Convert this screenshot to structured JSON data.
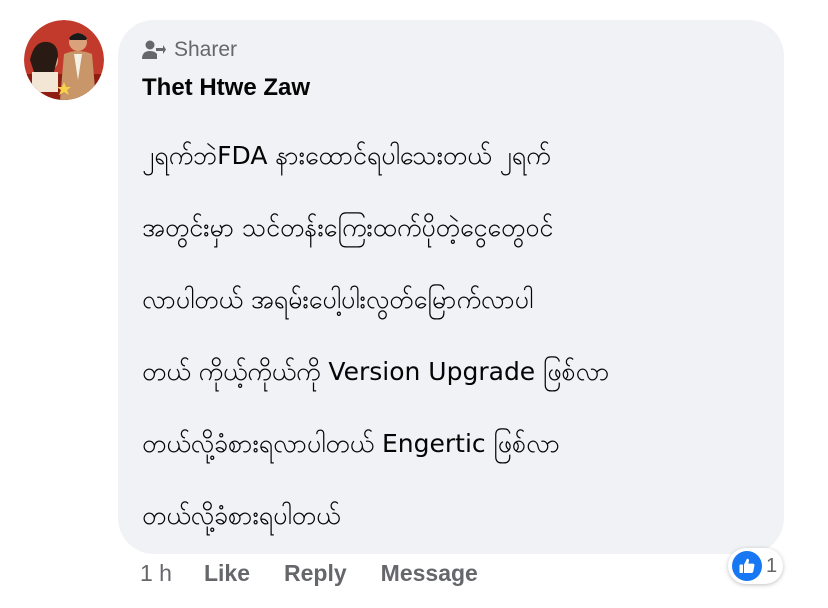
{
  "comment": {
    "sharer_label": "Sharer",
    "author_name": "Thet Htwe Zaw",
    "lines": [
      "၂ရက်ဘဲFDA  နားထောင်ရပါသေးတယ် ၂ရက်",
      "အတွင်းမှာ သင်တန်းကြေးထက်ပိုတဲ့ငွေတွေဝင်",
      "လာပါတယ် အရမ်းပေါ့ပါးလွတ်မြောက်လာပါ",
      "တယ် ကိုယ့်ကိုယ်ကို Version Upgrade ဖြစ်လာ",
      "တယ်လို့ခံစားရလာပါတယ် Engertic ဖြစ်လာ",
      "တယ်လို့ခံစားရပါတယ်"
    ]
  },
  "actions": {
    "time": "1 h",
    "like": "Like",
    "reply": "Reply",
    "message": "Message"
  },
  "reactions": {
    "count": "1",
    "icon": "thumbs-up-icon"
  },
  "colors": {
    "bubble": "#f0f2f5",
    "like_blue": "#1877f2",
    "secondary_text": "#65676b"
  }
}
